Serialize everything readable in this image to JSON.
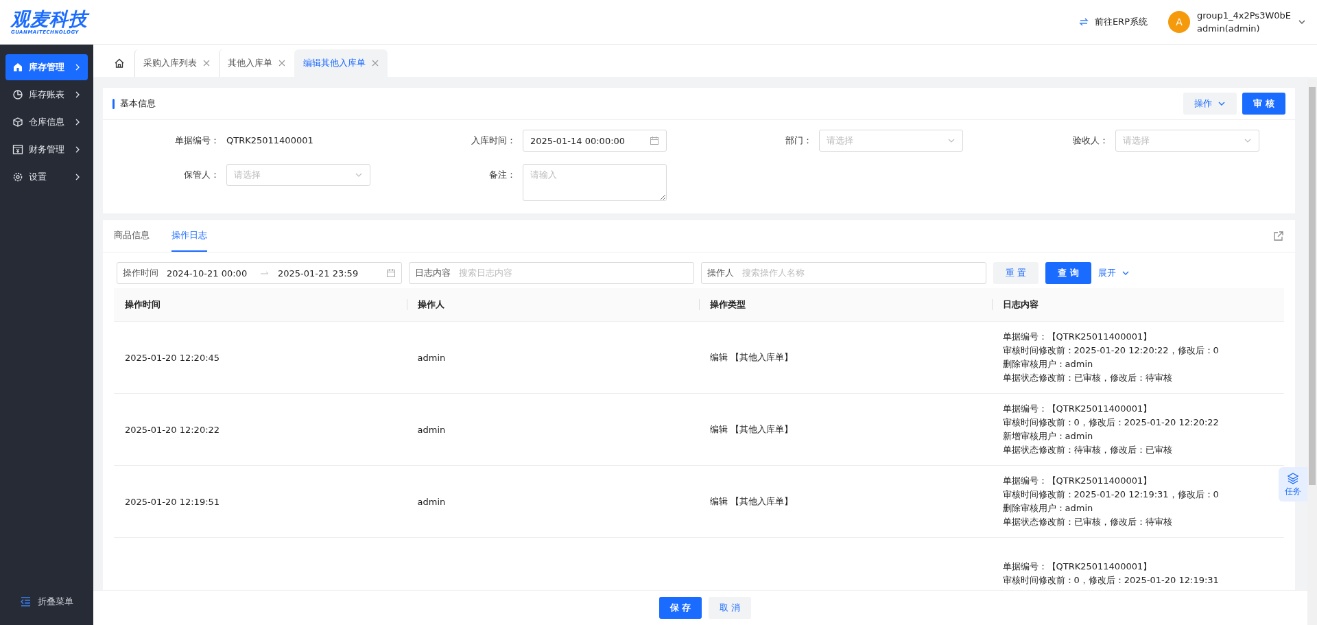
{
  "logo": {
    "title": "观麦科技",
    "subtitle": "GUANMAITECHNOLOGY"
  },
  "header": {
    "erp_link": "前往ERP系统",
    "avatar": "A",
    "user_group": "group1_4x2Ps3W0bE",
    "user_name": "admin(admin)"
  },
  "sidebar": {
    "items": [
      {
        "label": "库存管理",
        "selected": true,
        "kind": "home"
      },
      {
        "label": "库存账表",
        "selected": false,
        "kind": "chart"
      },
      {
        "label": "仓库信息",
        "selected": false,
        "kind": "box"
      },
      {
        "label": "财务管理",
        "selected": false,
        "kind": "money"
      },
      {
        "label": "设置",
        "selected": false,
        "kind": "gear"
      }
    ],
    "collapse": "折叠菜单"
  },
  "tabs": [
    {
      "label": "采购入库列表",
      "selected": false
    },
    {
      "label": "其他入库单",
      "selected": false
    },
    {
      "label": "编辑其他入库单",
      "selected": true
    }
  ],
  "basic_info": {
    "title": "基本信息",
    "operate_button": "操作",
    "approve_button": "审 核",
    "fields": [
      {
        "kind": "text",
        "label": "单据编号：",
        "value": "QTRK25011400001"
      },
      {
        "kind": "date",
        "label": "入库时间：",
        "value": "2025-01-14 00:00:00"
      },
      {
        "kind": "select",
        "label": "部门：",
        "placeholder": "请选择"
      },
      {
        "kind": "select",
        "label": "验收人：",
        "placeholder": "请选择"
      },
      {
        "kind": "select",
        "label": "保管人：",
        "placeholder": "请选择"
      },
      {
        "kind": "textarea",
        "label": "备注：",
        "placeholder": "请输入"
      }
    ]
  },
  "detail_tabs": [
    {
      "label": "商品信息",
      "selected": false
    },
    {
      "label": "操作日志",
      "selected": true
    }
  ],
  "filters": {
    "time_label": "操作时间",
    "time_start": "2024-10-21 00:00",
    "time_end": "2025-01-21 23:59",
    "content_label": "日志内容",
    "content_placeholder": "搜索日志内容",
    "operator_label": "操作人",
    "operator_placeholder": "搜索操作人名称",
    "reset": "重 置",
    "query": "查 询",
    "expand": "展开"
  },
  "table": {
    "columns": [
      "操作时间",
      "操作人",
      "操作类型",
      "日志内容"
    ],
    "rows": [
      {
        "time": "2025-01-20 12:20:45",
        "operator": "admin",
        "type": "编辑 【其他入库单】",
        "log_lines": [
          "单据编号：【QTRK25011400001】",
          "审核时间修改前：2025-01-20 12:20:22，修改后：0",
          "删除审核用户：admin",
          "单据状态修改前：已审核，修改后：待审核"
        ]
      },
      {
        "time": "2025-01-20 12:20:22",
        "operator": "admin",
        "type": "编辑 【其他入库单】",
        "log_lines": [
          "单据编号：【QTRK25011400001】",
          "审核时间修改前：0，修改后：2025-01-20 12:20:22",
          "新增审核用户：admin",
          "单据状态修改前：待审核，修改后：已审核"
        ]
      },
      {
        "time": "2025-01-20 12:19:51",
        "operator": "admin",
        "type": "编辑 【其他入库单】",
        "log_lines": [
          "单据编号：【QTRK25011400001】",
          "审核时间修改前：2025-01-20 12:19:31，修改后：0",
          "删除审核用户：admin",
          "单据状态修改前：已审核，修改后：待审核"
        ]
      },
      {
        "log_lines": [
          "单据编号：【QTRK25011400001】",
          "审核时间修改前：0，修改后：2025-01-20 12:19:31"
        ]
      }
    ]
  },
  "side_widget": {
    "label": "任务"
  },
  "footer": {
    "save": "保 存",
    "cancel": "取 消"
  }
}
